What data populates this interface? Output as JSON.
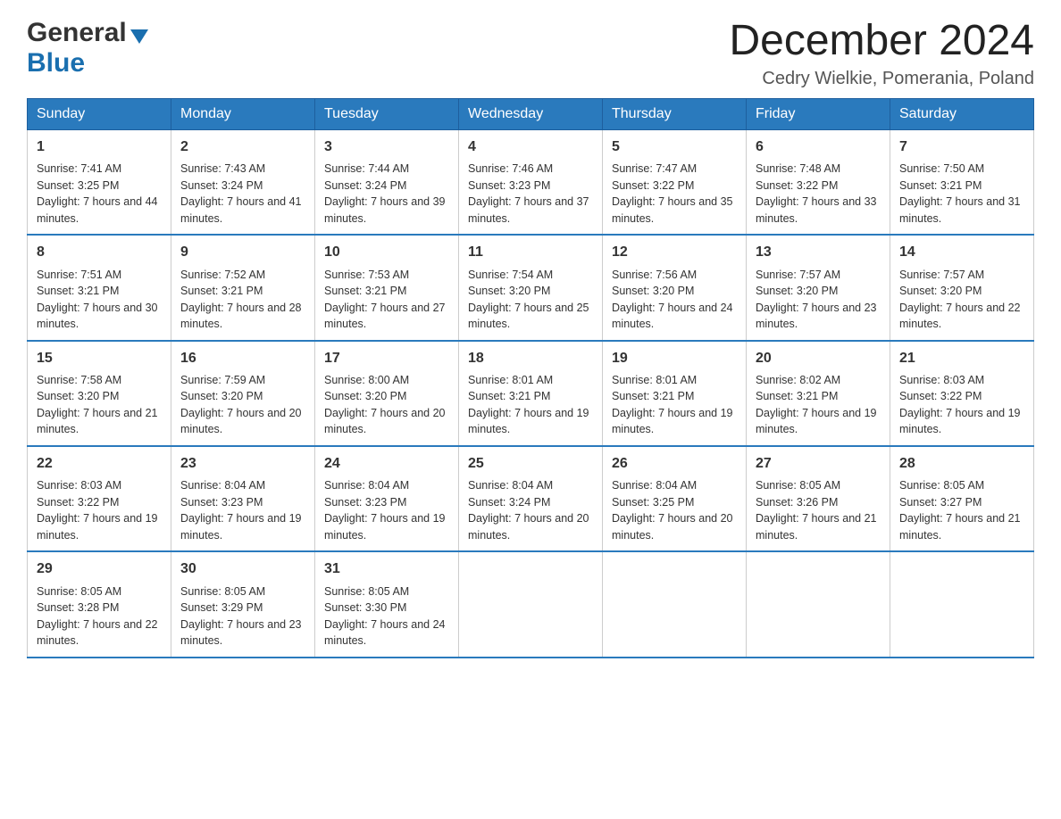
{
  "header": {
    "logo_general": "General",
    "logo_blue": "Blue",
    "month_title": "December 2024",
    "subtitle": "Cedry Wielkie, Pomerania, Poland"
  },
  "weekdays": [
    "Sunday",
    "Monday",
    "Tuesday",
    "Wednesday",
    "Thursday",
    "Friday",
    "Saturday"
  ],
  "weeks": [
    [
      {
        "day": "1",
        "sunrise": "7:41 AM",
        "sunset": "3:25 PM",
        "daylight": "7 hours and 44 minutes."
      },
      {
        "day": "2",
        "sunrise": "7:43 AM",
        "sunset": "3:24 PM",
        "daylight": "7 hours and 41 minutes."
      },
      {
        "day": "3",
        "sunrise": "7:44 AM",
        "sunset": "3:24 PM",
        "daylight": "7 hours and 39 minutes."
      },
      {
        "day": "4",
        "sunrise": "7:46 AM",
        "sunset": "3:23 PM",
        "daylight": "7 hours and 37 minutes."
      },
      {
        "day": "5",
        "sunrise": "7:47 AM",
        "sunset": "3:22 PM",
        "daylight": "7 hours and 35 minutes."
      },
      {
        "day": "6",
        "sunrise": "7:48 AM",
        "sunset": "3:22 PM",
        "daylight": "7 hours and 33 minutes."
      },
      {
        "day": "7",
        "sunrise": "7:50 AM",
        "sunset": "3:21 PM",
        "daylight": "7 hours and 31 minutes."
      }
    ],
    [
      {
        "day": "8",
        "sunrise": "7:51 AM",
        "sunset": "3:21 PM",
        "daylight": "7 hours and 30 minutes."
      },
      {
        "day": "9",
        "sunrise": "7:52 AM",
        "sunset": "3:21 PM",
        "daylight": "7 hours and 28 minutes."
      },
      {
        "day": "10",
        "sunrise": "7:53 AM",
        "sunset": "3:21 PM",
        "daylight": "7 hours and 27 minutes."
      },
      {
        "day": "11",
        "sunrise": "7:54 AM",
        "sunset": "3:20 PM",
        "daylight": "7 hours and 25 minutes."
      },
      {
        "day": "12",
        "sunrise": "7:56 AM",
        "sunset": "3:20 PM",
        "daylight": "7 hours and 24 minutes."
      },
      {
        "day": "13",
        "sunrise": "7:57 AM",
        "sunset": "3:20 PM",
        "daylight": "7 hours and 23 minutes."
      },
      {
        "day": "14",
        "sunrise": "7:57 AM",
        "sunset": "3:20 PM",
        "daylight": "7 hours and 22 minutes."
      }
    ],
    [
      {
        "day": "15",
        "sunrise": "7:58 AM",
        "sunset": "3:20 PM",
        "daylight": "7 hours and 21 minutes."
      },
      {
        "day": "16",
        "sunrise": "7:59 AM",
        "sunset": "3:20 PM",
        "daylight": "7 hours and 20 minutes."
      },
      {
        "day": "17",
        "sunrise": "8:00 AM",
        "sunset": "3:20 PM",
        "daylight": "7 hours and 20 minutes."
      },
      {
        "day": "18",
        "sunrise": "8:01 AM",
        "sunset": "3:21 PM",
        "daylight": "7 hours and 19 minutes."
      },
      {
        "day": "19",
        "sunrise": "8:01 AM",
        "sunset": "3:21 PM",
        "daylight": "7 hours and 19 minutes."
      },
      {
        "day": "20",
        "sunrise": "8:02 AM",
        "sunset": "3:21 PM",
        "daylight": "7 hours and 19 minutes."
      },
      {
        "day": "21",
        "sunrise": "8:03 AM",
        "sunset": "3:22 PM",
        "daylight": "7 hours and 19 minutes."
      }
    ],
    [
      {
        "day": "22",
        "sunrise": "8:03 AM",
        "sunset": "3:22 PM",
        "daylight": "7 hours and 19 minutes."
      },
      {
        "day": "23",
        "sunrise": "8:04 AM",
        "sunset": "3:23 PM",
        "daylight": "7 hours and 19 minutes."
      },
      {
        "day": "24",
        "sunrise": "8:04 AM",
        "sunset": "3:23 PM",
        "daylight": "7 hours and 19 minutes."
      },
      {
        "day": "25",
        "sunrise": "8:04 AM",
        "sunset": "3:24 PM",
        "daylight": "7 hours and 20 minutes."
      },
      {
        "day": "26",
        "sunrise": "8:04 AM",
        "sunset": "3:25 PM",
        "daylight": "7 hours and 20 minutes."
      },
      {
        "day": "27",
        "sunrise": "8:05 AM",
        "sunset": "3:26 PM",
        "daylight": "7 hours and 21 minutes."
      },
      {
        "day": "28",
        "sunrise": "8:05 AM",
        "sunset": "3:27 PM",
        "daylight": "7 hours and 21 minutes."
      }
    ],
    [
      {
        "day": "29",
        "sunrise": "8:05 AM",
        "sunset": "3:28 PM",
        "daylight": "7 hours and 22 minutes."
      },
      {
        "day": "30",
        "sunrise": "8:05 AM",
        "sunset": "3:29 PM",
        "daylight": "7 hours and 23 minutes."
      },
      {
        "day": "31",
        "sunrise": "8:05 AM",
        "sunset": "3:30 PM",
        "daylight": "7 hours and 24 minutes."
      },
      null,
      null,
      null,
      null
    ]
  ],
  "labels": {
    "sunrise": "Sunrise:",
    "sunset": "Sunset:",
    "daylight": "Daylight:"
  }
}
